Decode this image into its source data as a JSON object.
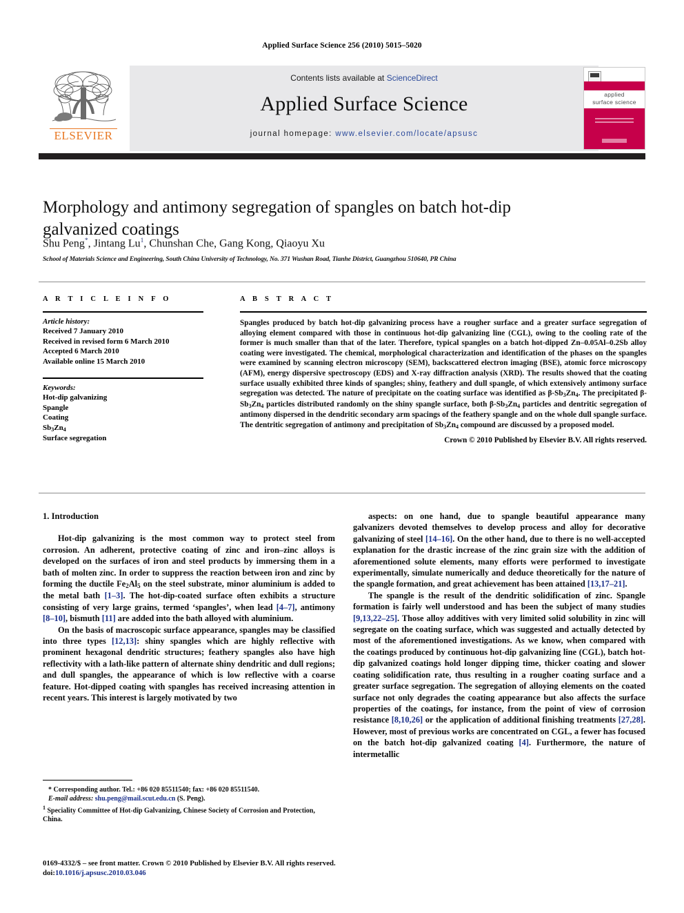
{
  "running_head": "Applied Surface Science 256 (2010) 5015–5020",
  "masthead": {
    "contents_prefix": "Contents lists available at ",
    "sciencedirect": "ScienceDirect",
    "journal_title": "Applied Surface Science",
    "homepage_prefix": "journal homepage: ",
    "homepage_url": "www.elsevier.com/locate/apsusc",
    "publisher_wordmark": "ELSEVIER",
    "publisher_color": "#e87722",
    "link_color": "#2b4a9b",
    "band_color": "#e8e8ea",
    "cover": {
      "title_line1": "applied",
      "title_line2": "surface science",
      "color": "#c6004a"
    }
  },
  "article": {
    "title": "Morphology and antimony segregation of spangles on batch hot-dip galvanized coatings",
    "authors_html": "Shu Peng<sup>*</sup>, Jintang Lu<sup>1</sup>, Chunshan Che, Gang Kong, Qiaoyu Xu",
    "affiliation": "School of Materials Science and Engineering, South China University of Technology, No. 371 Wushan Road, Tianhe District, Guangzhou 510640, PR China"
  },
  "article_info": {
    "heading": "A R T I C L E   I N F O",
    "history_label": "Article history:",
    "history": [
      "Received 7 January 2010",
      "Received in revised form 6 March 2010",
      "Accepted 6 March 2010",
      "Available online 15 March 2010"
    ],
    "keywords_label": "Keywords:",
    "keywords_html": [
      "Hot-dip galvanizing",
      "Spangle",
      "Coating",
      "Sb<sub>3</sub>Zn<sub>4</sub>",
      "Surface segregation"
    ]
  },
  "abstract": {
    "heading": "A B S T R A C T",
    "body_html": "Spangles produced by batch hot-dip galvanizing process have a rougher surface and a greater surface segregation of alloying element compared with those in continuous hot-dip galvanizing line (CGL), owing to the cooling rate of the former is much smaller than that of the later. Therefore, typical spangles on a batch hot-dipped Zn–0.05Al–0.2Sb alloy coating were investigated. The chemical, morphological characterization and identification of the phases on the spangles were examined by scanning electron microscopy (SEM), backscattered electron imaging (BSE), atomic force microscopy (AFM), energy dispersive spectroscopy (EDS) and X-ray diffraction analysis (XRD). The results showed that the coating surface usually exhibited three kinds of spangles; shiny, feathery and dull spangle, of which extensively antimony surface segregation was detected. The nature of precipitate on the coating surface was identified as β-Sb<sub>3</sub>Zn<sub>4</sub>. The precipitated β-Sb<sub>3</sub>Zn<sub>4</sub> particles distributed randomly on the shiny spangle surface, both β-Sb<sub>3</sub>Zn<sub>4</sub> particles and dentritic segregation of antimony dispersed in the dendritic secondary arm spacings of the feathery spangle and on the whole dull spangle surface. The dentritic segregation of antimony and precipitation of Sb<sub>3</sub>Zn<sub>4</sub> compound are discussed by a proposed model.",
    "copyright": "Crown © 2010 Published by Elsevier B.V. All rights reserved."
  },
  "body": {
    "section_heading": "1.  Introduction",
    "left_paragraphs_html": [
      "Hot-dip galvanizing is the most common way to protect steel from corrosion. An adherent, protective coating of zinc and iron–zinc alloys is developed on the surfaces of iron and steel products by immersing them in a bath of molten zinc. In order to suppress the reaction between iron and zinc by forming the ductile Fe<sub>2</sub>Al<sub>5</sub> on the steel substrate, minor aluminium is added to the metal bath <span class=\"ref\">[1–3]</span>. The hot-dip-coated surface often exhibits a structure consisting of very large grains, termed ‘spangles’, when lead <span class=\"ref\">[4–7]</span>, antimony <span class=\"ref\">[8–10]</span>, bismuth <span class=\"ref\">[11]</span> are added into the bath alloyed with aluminium.",
      "On the basis of macroscopic surface appearance, spangles may be classified into three types <span class=\"ref\">[12,13]</span>: shiny spangles which are highly reflective with prominent hexagonal dendritic structures; feathery spangles also have high reflectivity with a lath-like pattern of alternate shiny dendritic and dull regions; and dull spangles, the appearance of which is low reflective with a coarse feature. Hot-dipped coating with spangles has received increasing attention in recent years. This interest is largely motivated by two"
    ],
    "right_paragraphs_html": [
      "aspects: on one hand, due to spangle beautiful appearance many galvanizers devoted themselves to develop process and alloy for decorative galvanizing of steel <span class=\"ref\">[14–16]</span>. On the other hand, due to there is no well-accepted explanation for the drastic increase of the zinc grain size with the addition of aforementioned solute elements, many efforts were performed to investigate experimentally, simulate numerically and deduce theoretically for the nature of the spangle formation, and great achievement has been attained <span class=\"ref\">[13,17–21]</span>.",
      "The spangle is the result of the dendritic solidification of zinc. Spangle formation is fairly well understood and has been the subject of many studies <span class=\"ref\">[9,13,22–25]</span>. Those alloy additives with very limited solid solubility in zinc will segregate on the coating surface, which was suggested and actually detected by most of the aforementioned investigations. As we know, when compared with the coatings produced by continuous hot-dip galvanizing line (CGL), batch hot-dip galvanized coatings hold longer dipping time, thicker coating and slower coating solidification rate, thus resulting in a rougher coating surface and a greater surface segregation. The segregation of alloying elements on the coated surface not only degrades the coating appearance but also affects the surface properties of the coatings, for instance, from the point of view of corrosion resistance <span class=\"ref\">[8,10,26]</span> or the application of additional finishing treatments <span class=\"ref\">[27,28]</span>. However, most of previous works are concentrated on CGL, a fewer has focused on the batch hot-dip galvanized coating <span class=\"ref\">[4]</span>. Furthermore, the nature of intermetallic"
    ]
  },
  "footnotes": {
    "corresponding_html": "* Corresponding author. Tel.: +86 020 85511540; fax: +86 020 85511540.",
    "email_label": "E-mail address:",
    "email": "shu.peng@mail.scut.edu.cn",
    "email_suffix": "(S. Peng).",
    "note1_html": "<sup>1</sup>  Speciality Committee of Hot-dip Galvanizing, Chinese Society of Corrosion and Protection, China."
  },
  "footer": {
    "front_matter": "0169-4332/$ – see front matter. Crown © 2010 Published by Elsevier B.V. All rights reserved.",
    "doi_label": "doi:",
    "doi": "10.1016/j.apsusc.2010.03.046"
  }
}
